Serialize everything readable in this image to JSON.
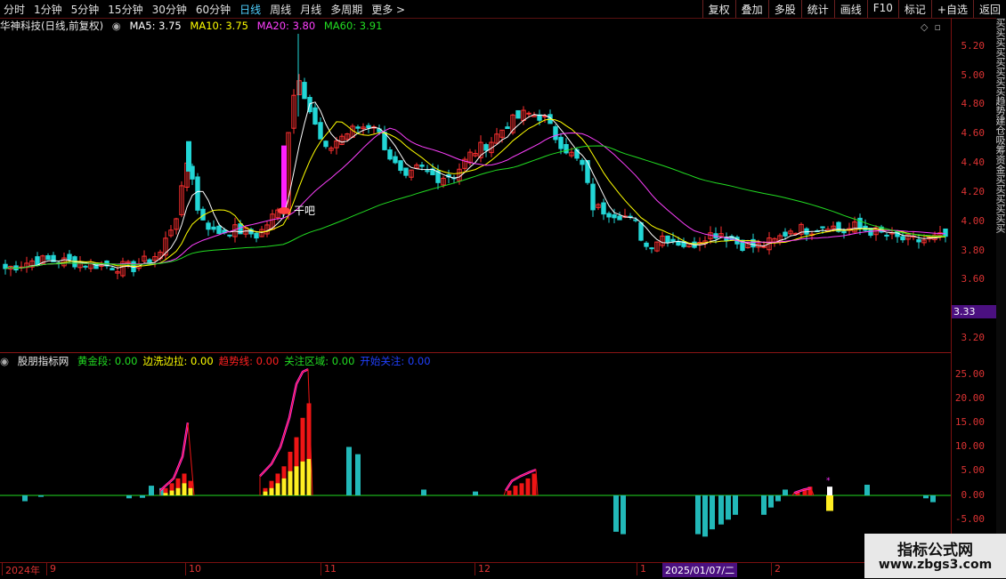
{
  "toolbar": {
    "periods": [
      "分时",
      "1分钟",
      "5分钟",
      "15分钟",
      "30分钟",
      "60分钟",
      "日线",
      "周线",
      "月线",
      "多周期",
      "更多 >"
    ],
    "active_period": "日线",
    "actions": [
      "复权",
      "叠加",
      "多股",
      "统计",
      "画线",
      "F10",
      "标记",
      "+自选",
      "返回"
    ]
  },
  "main": {
    "title": "华神科技(日线,前复权)",
    "ma5": "MA5: 3.75",
    "ma10": "MA10: 3.75",
    "ma20": "MA20: 3.80",
    "ma60": "MA60: 3.91",
    "annotation": "干吧",
    "price_tag": "3.33",
    "y_labels": [
      "5.20",
      "5.00",
      "4.80",
      "4.60",
      "4.40",
      "4.20",
      "4.00",
      "3.80",
      "3.60",
      "3.20"
    ],
    "colors": {
      "ma5": "#ffffff",
      "ma10": "#ffff00",
      "ma20": "#ff40ff",
      "ma60": "#22dd22",
      "up": "#ff3030",
      "down": "#22d6d6"
    }
  },
  "indicator": {
    "name": "股朋指标网",
    "fields": [
      {
        "label": "黄金段: 0.00",
        "color": "#22dd22"
      },
      {
        "label": "边洗边拉: 0.00",
        "color": "#ffff00"
      },
      {
        "label": "趋势线: 0.00",
        "color": "#ff2020"
      },
      {
        "label": "关注区域: 0.00",
        "color": "#22dd22"
      },
      {
        "label": "开始关注: 0.00",
        "color": "#2040ff"
      }
    ],
    "y_labels": [
      "25.00",
      "20.00",
      "15.00",
      "10.00",
      "5.00",
      "0.00",
      "-5.00"
    ]
  },
  "xaxis": {
    "ticks": [
      "2024年",
      "9",
      "10",
      "11",
      "12",
      "1",
      "2"
    ],
    "date_tag": "2025/01/07/二"
  },
  "watermark": {
    "line1": "指标公式网",
    "line2": "www.zbgs3.com"
  },
  "right_strip": "买买买买买买买买趋势建仓吸筹资金买买买买买买"
}
